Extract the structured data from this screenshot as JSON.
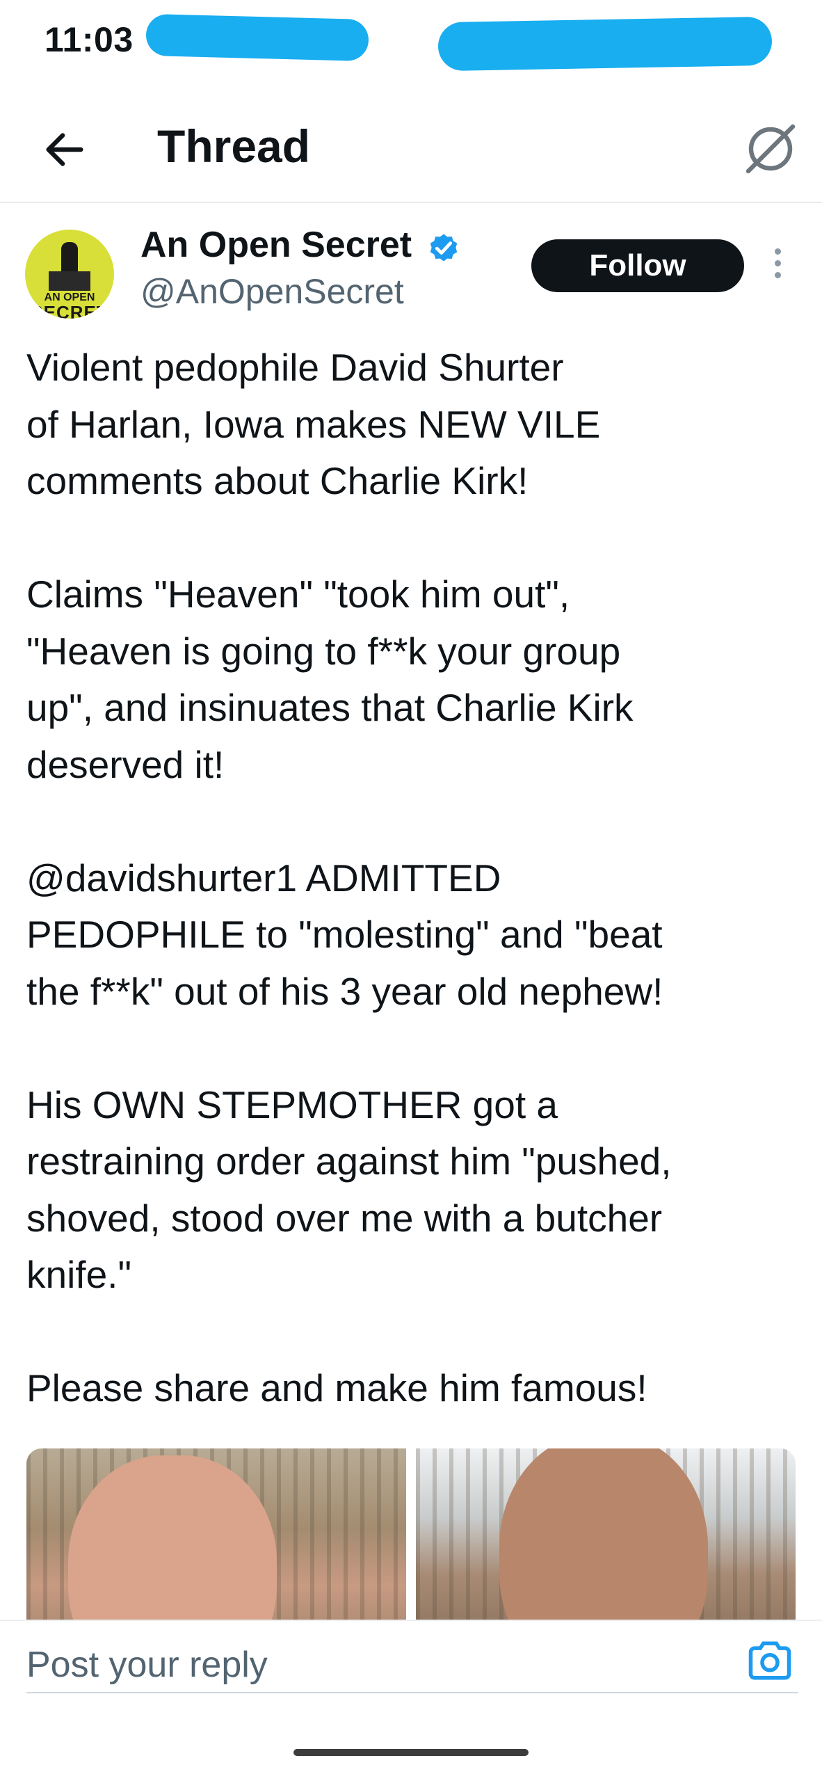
{
  "status_bar": {
    "time": "11:03"
  },
  "header": {
    "title": "Thread",
    "back_icon": "arrow-left-icon",
    "grok_icon": "grok-icon"
  },
  "tweet": {
    "author_name": "An Open Secret",
    "handle": "@AnOpenSecret",
    "verified": true,
    "avatar_text": [
      "AN OPEN",
      "SECRET"
    ],
    "follow_label": "Follow",
    "text": "Violent pedophile David Shurter\nof Harlan, Iowa makes NEW VILE\ncomments about Charlie Kirk!\n\nClaims \"Heaven\" \"took him out\",\n\"Heaven is going to f**k your group\nup\", and insinuates that Charlie Kirk\ndeserved it!\n\n@davidshurter1 ADMITTED\nPEDOPHILE to \"molesting\" and \"beat\nthe f**k\" out of his 3 year old nephew!\n\nHis OWN STEPMOTHER got a\nrestraining order against him \"pushed,\nshoved, stood over me with a butcher\nknife.\"\n\nPlease share and make him famous!"
  },
  "reply": {
    "placeholder": "Post your reply"
  },
  "colors": {
    "accent": "#1d9bf0",
    "text": "#0f1419",
    "secondary": "#536471",
    "redaction": "#18aef0"
  }
}
